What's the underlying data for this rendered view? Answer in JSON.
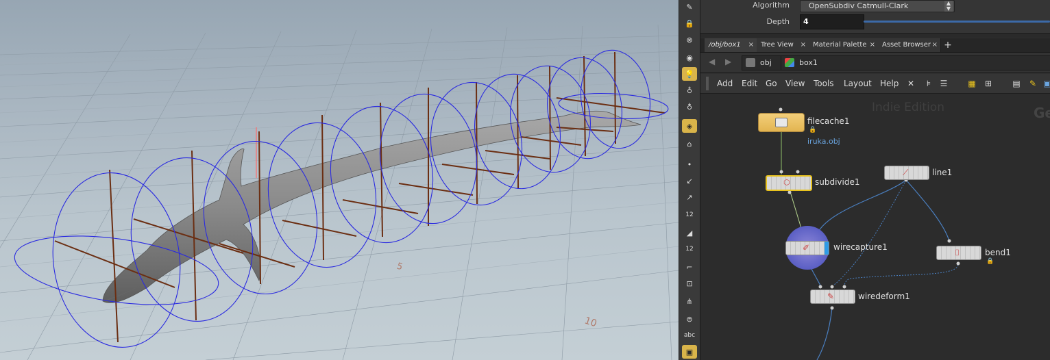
{
  "parameters": {
    "algorithm_label": "Algorithm",
    "algorithm_value": "OpenSubdiv Catmull-Clark",
    "depth_label": "Depth",
    "depth_value": "4"
  },
  "tabs": [
    {
      "label": "/obj/box1"
    },
    {
      "label": "Tree View"
    },
    {
      "label": "Material Palette"
    },
    {
      "label": "Asset Browser"
    }
  ],
  "path": {
    "root": "obj",
    "node": "box1"
  },
  "menu": [
    "Add",
    "Edit",
    "Go",
    "View",
    "Tools",
    "Layout",
    "Help"
  ],
  "network": {
    "watermark": "Indie Edition",
    "watermark2": "Ge",
    "nodes": {
      "filecache": "filecache1",
      "filecache_file": "iruka.obj",
      "subdivide": "subdivide1",
      "line": "line1",
      "wirecapture": "wirecapture1",
      "bend": "bend1",
      "wiredeform": "wiredeform1"
    }
  },
  "viewport": {
    "ground_labels": [
      "5",
      "10"
    ]
  },
  "toolbar": {
    "label_12a": "12",
    "label_12b": "12",
    "label_abc": "abc"
  },
  "colors": {
    "ring": "#2a2ae0",
    "rib": "#6b2e12",
    "accent_blue": "#3c6aa8",
    "selected_node": "#e8c21e"
  }
}
